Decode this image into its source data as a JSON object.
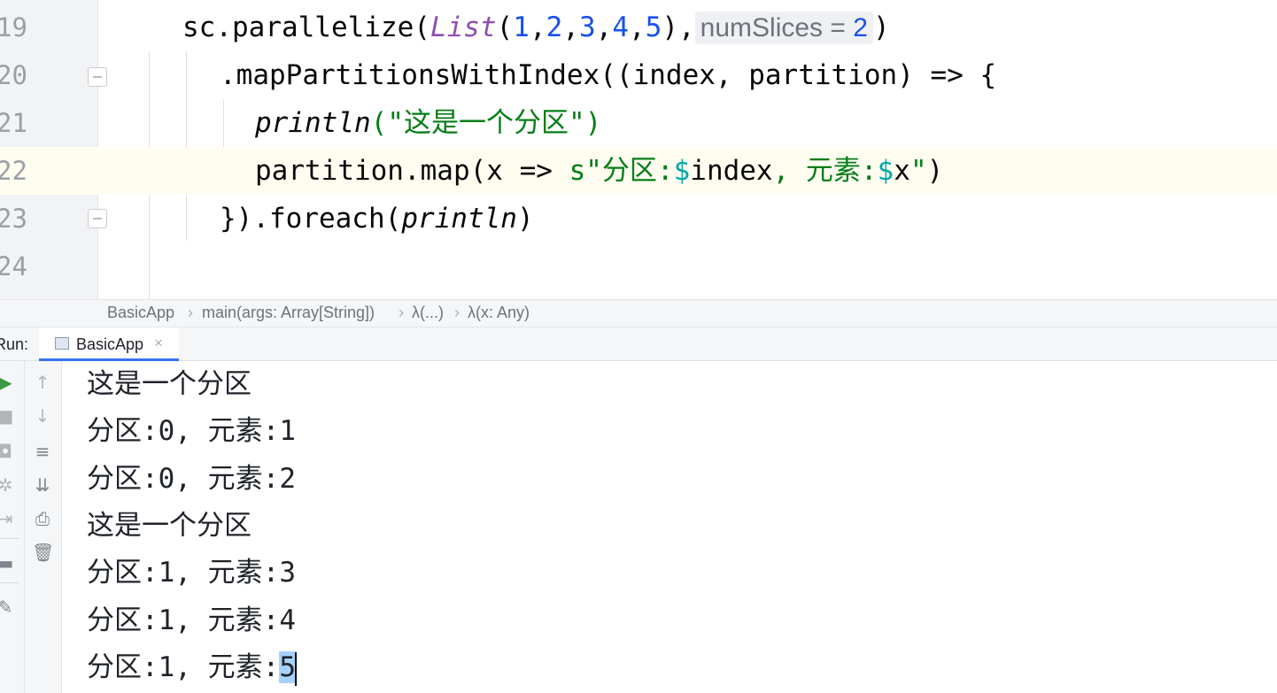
{
  "editor": {
    "lines": [
      {
        "num": "19"
      },
      {
        "num": "20"
      },
      {
        "num": "21"
      },
      {
        "num": "22"
      },
      {
        "num": "23"
      },
      {
        "num": "24"
      }
    ],
    "code": {
      "l19": {
        "a": "sc.parallelize(",
        "list": "List",
        "b": "(",
        "nums": [
          "1",
          "2",
          "3",
          "4",
          "5"
        ],
        "c": "),",
        "hint": "numSlices = ",
        "hint_val": "2",
        "d": ")"
      },
      "l20": {
        "text": ".mapPartitionsWithIndex((index, partition) => {"
      },
      "l21": {
        "fn": "println",
        "rest": "(\"这是一个分区\")"
      },
      "l22": {
        "a": "partition.map(x => ",
        "s": "s\"分区:",
        "dollar1": "$",
        "index": "index",
        "mid": ", 元素:",
        "dollar2": "$",
        "x": "x",
        "end_quote": "\"",
        "end": ")"
      },
      "l23": {
        "a": "}).foreach(",
        "fn": "println",
        "b": ")"
      }
    }
  },
  "breadcrumb": {
    "items": [
      "BasicApp",
      "main(args: Array[String])",
      "λ(...)",
      "λ(x: Any)"
    ],
    "sep": "›"
  },
  "run": {
    "label": "Run:",
    "tab_label": "BasicApp",
    "close": "×"
  },
  "toolbar": {
    "icons": [
      "play-icon",
      "stop-icon",
      "camera-icon",
      "debug-icon",
      "exit-icon",
      "layout-icon",
      "pin-icon"
    ],
    "icons2": [
      "arrow-up-icon",
      "arrow-down-icon",
      "soft-wrap-icon",
      "scroll-to-end-icon",
      "print-icon",
      "trash-icon"
    ]
  },
  "console": {
    "lines": [
      "这是一个分区",
      "分区:0, 元素:1",
      "分区:0, 元素:2",
      "这是一个分区",
      "分区:1, 元素:3",
      "分区:1, 元素:4"
    ],
    "last_prefix": "分区:1, 元素:",
    "last_selected": "5"
  }
}
